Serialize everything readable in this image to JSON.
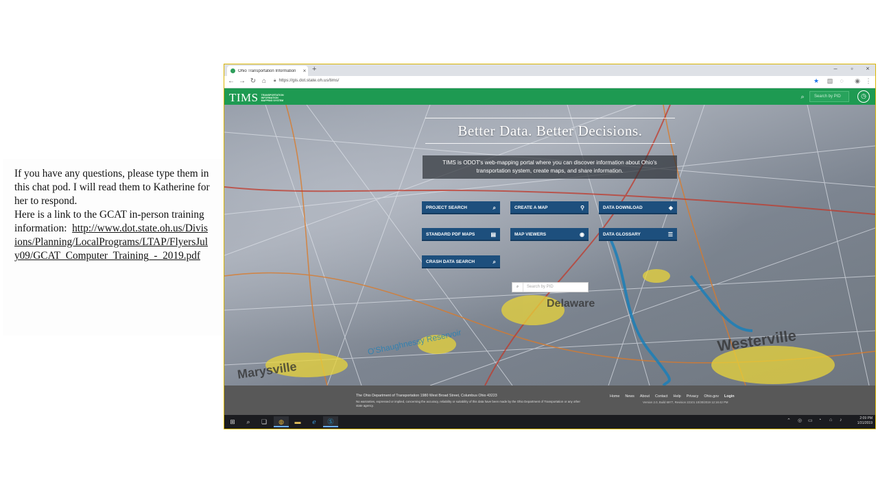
{
  "chat": {
    "line1": "If you have any questions, please type them in this chat pod.  I will read them to Katherine for her to respond.",
    "line2": "Here is a link to the GCAT in-person training information:",
    "link": "http://www.dot.state.oh.us/Divisions/Planning/LocalPrograms/LTAP/FlyersJuly09/GCAT_Computer_Training_-_2019.pdf"
  },
  "browser": {
    "tab_title": "Ohio Transportation Information",
    "tab_close": "×",
    "new_tab": "+",
    "url": "https://gis.dot.state.oh.us/tims/",
    "win_min": "–",
    "win_max": "▫",
    "win_close": "×"
  },
  "header": {
    "logo": "TIMS",
    "logo_sub_1": "TRANSPORTATION",
    "logo_sub_2": "INFORMATION",
    "logo_sub_3": "MAPPING SYSTEM",
    "search_placeholder": "Search by PID"
  },
  "hero": {
    "tagline": "Better Data. Better Decisions.",
    "intro": "TIMS is ODOT's web-mapping portal where you can discover information about Ohio's transportation system, create maps, and share information.",
    "tiles": [
      {
        "label": "PROJECT SEARCH",
        "icon": "search-icon"
      },
      {
        "label": "CREATE A MAP",
        "icon": "map-pin-icon"
      },
      {
        "label": "DATA DOWNLOAD",
        "icon": "layers-icon"
      },
      {
        "label": "STANDARD PDF MAPS",
        "icon": "document-icon"
      },
      {
        "label": "MAP VIEWERS",
        "icon": "eye-icon"
      },
      {
        "label": "DATA GLOSSARY",
        "icon": "list-icon"
      },
      {
        "label": "CRASH DATA SEARCH",
        "icon": "search-icon"
      }
    ],
    "search_placeholder": "Search by PID"
  },
  "footer": {
    "address": "The Ohio Department of Transportation 1980 West Broad Street, Columbus Ohio 43223",
    "disclaimer": "No warranties, expressed or implied, concerning the accuracy, reliability or suitability of this data have been made by the Ohio Department of Transportation or any other state agency.",
    "links": [
      "Home",
      "News",
      "About",
      "Contact",
      "Help",
      "Privacy",
      "Ohio.gov",
      "Login"
    ],
    "version": "Version 2.0, Build 6977, Revision 22101 10/30/2019 12:16:42 PM"
  },
  "taskbar": {
    "time": "2:09 PM",
    "date": "1/31/2019"
  },
  "colors": {
    "tims_green": "#1e9a52",
    "tile_blue": "#1d4f7d",
    "footer_gray": "#585858"
  }
}
